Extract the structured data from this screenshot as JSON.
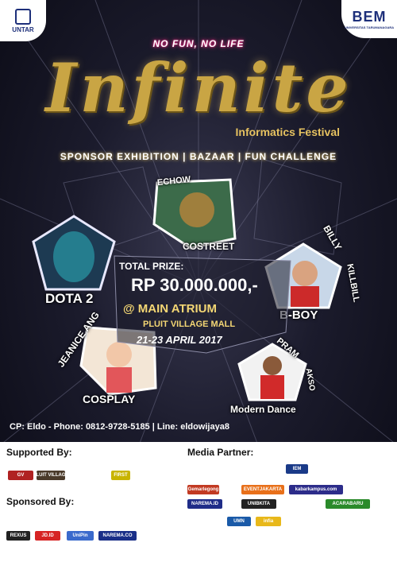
{
  "header": {
    "left_logo_text": "UNTAR",
    "right_logo_text": "BEM",
    "right_logo_caption": "UNIVERSITAS TARUMANAGARA",
    "tagline": "NO FUN, NO LIFE",
    "title": "Infinite",
    "subtitle": "Informatics Festival",
    "events": "SPONSOR EXHIBITION | BAZAAR | FUN CHALLENGE"
  },
  "competitions": {
    "dota": "DOTA 2",
    "echow": "ECHOW",
    "costreet": "COSTREET",
    "billy": "BILLY",
    "killbill": "KILLBILL",
    "bboy": "B-BOY",
    "jeanice": "JEANICE ANG",
    "cosplay": "COSPLAY",
    "pram": "PRAM",
    "akso": "AKSO",
    "modern_dance": "Modern Dance"
  },
  "prize": {
    "label": "TOTAL PRIZE:",
    "amount": "RP 30.000.000,-",
    "venue_line1": "@ MAIN ATRIUM",
    "venue_line2": "PLUIT VILLAGE MALL",
    "dates": "21-23 APRIL 2017"
  },
  "contact": "CP: Eldo - Phone: 0812-9728-5185 | Line: eldowijaya8",
  "sponsors": {
    "supported_title": "Supported By:",
    "sponsored_title": "Sponsored By:",
    "media_title": "Media Partner:",
    "supported_logos": [
      "GV",
      "PLUIT VILLAGE",
      "FIRST"
    ],
    "sponsored_logos": [
      "REXUS",
      "JD.ID",
      "UniPin",
      "NAREMA.CO"
    ],
    "media_logos": [
      "Gemarlegong",
      "EVENTJAKARTA",
      "kabarkampus.com",
      "NAREMA.ID",
      "UNIBKITA",
      "infia",
      "UMN",
      "ACARABARU",
      "IEM"
    ]
  }
}
